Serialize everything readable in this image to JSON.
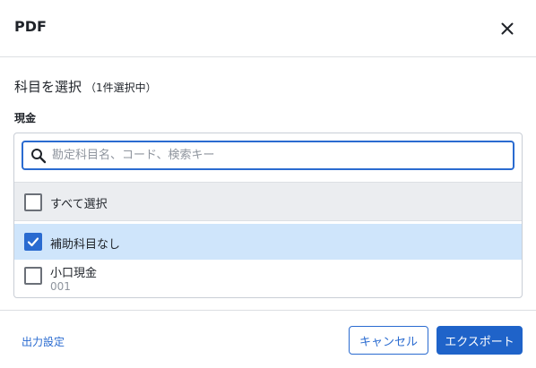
{
  "dialog": {
    "title": "PDF",
    "close_icon": "close-icon"
  },
  "selection": {
    "heading": "科目を選択",
    "count_text": "（1件選択中）",
    "group_label": "現金"
  },
  "search": {
    "placeholder": "勘定科目名、コード、検索キー",
    "value": "",
    "icon": "search-icon"
  },
  "list": {
    "select_all_label": "すべて選択",
    "select_all_checked": false,
    "items": [
      {
        "label": "補助科目なし",
        "code": "",
        "checked": true
      },
      {
        "label": "小口現金",
        "code": "001",
        "checked": false
      }
    ]
  },
  "footer": {
    "output_settings_label": "出力設定",
    "cancel_label": "キャンセル",
    "export_label": "エクスポート"
  },
  "colors": {
    "accent": "#2a6bd0",
    "selected_row_bg": "#cfe5fb",
    "select_all_bg": "#ebedf0",
    "export_button_bg": "#1f63c9"
  }
}
